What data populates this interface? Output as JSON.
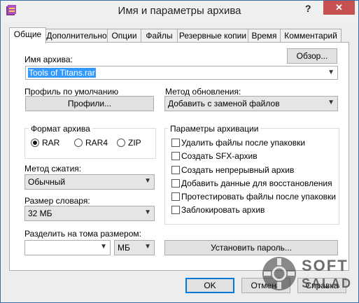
{
  "window": {
    "title": "Имя и параметры архива",
    "help_glyph": "?",
    "close_glyph": "✕"
  },
  "tabs": [
    {
      "label": "Общие",
      "active": true
    },
    {
      "label": "Дополнительно"
    },
    {
      "label": "Опции"
    },
    {
      "label": "Файлы"
    },
    {
      "label": "Резервные копии"
    },
    {
      "label": "Время"
    },
    {
      "label": "Комментарий"
    }
  ],
  "archive_name": {
    "label": "Имя архива:",
    "value": "Tools of Titans.rar",
    "browse_button": "Обзор..."
  },
  "profile": {
    "label": "Профиль по умолчанию",
    "button": "Профили..."
  },
  "update_method": {
    "label": "Метод обновления:",
    "value": "Добавить с заменой файлов"
  },
  "archive_format": {
    "label": "Формат архива",
    "options": [
      "RAR",
      "RAR4",
      "ZIP"
    ],
    "selected": "RAR"
  },
  "compression": {
    "label": "Метод сжатия:",
    "value": "Обычный"
  },
  "dictionary": {
    "label": "Размер словаря:",
    "value": "32 МБ"
  },
  "split": {
    "label": "Разделить на тома размером:",
    "value": "",
    "unit": "МБ"
  },
  "archive_options": {
    "label": "Параметры архивации",
    "items": [
      {
        "label": "Удалить файлы после упаковки",
        "checked": false
      },
      {
        "label": "Создать SFX-архив",
        "checked": false
      },
      {
        "label": "Создать непрерывный архив",
        "checked": false
      },
      {
        "label": "Добавить данные для восстановления",
        "checked": false
      },
      {
        "label": "Протестировать файлы после упаковки",
        "checked": false
      },
      {
        "label": "Заблокировать архив",
        "checked": false
      }
    ]
  },
  "set_password_button": "Установить пароль...",
  "footer": {
    "ok": "OK",
    "cancel": "Отмена",
    "help": "Справка"
  },
  "watermark": {
    "line1": "SOFT",
    "line2": "SALAD"
  },
  "colors": {
    "accent": "#0078d7",
    "selection": "#3399ff",
    "close": "#c75050"
  }
}
